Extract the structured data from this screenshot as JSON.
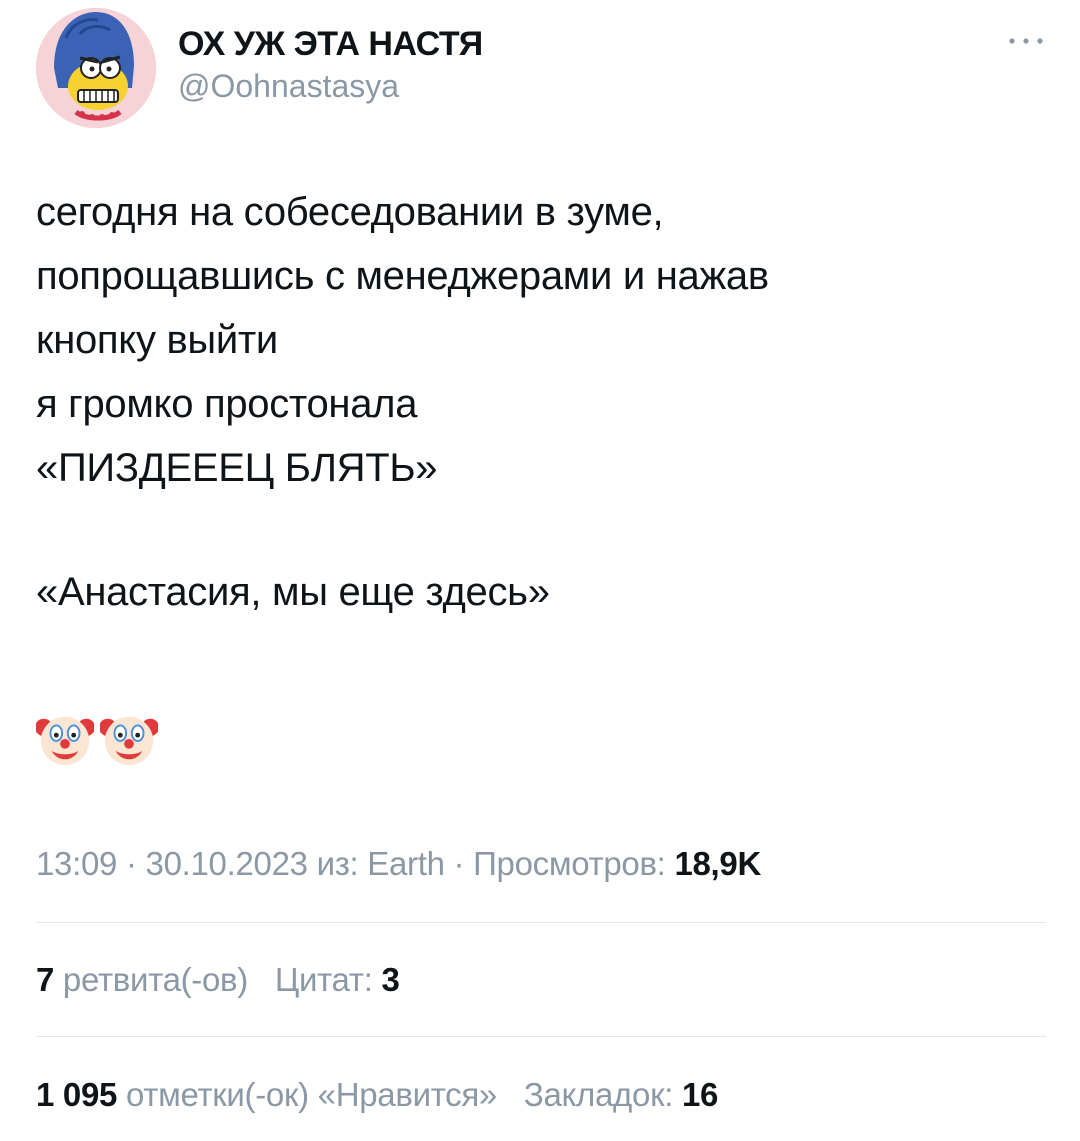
{
  "author": {
    "display_name": "ОХ УЖ ЭТА НАСТЯ",
    "handle": "@Oohnastasya",
    "avatar_icon": "cartoon-marge-avatar"
  },
  "more_menu": {
    "icon": "more-dots-icon"
  },
  "tweet": {
    "lines": [
      "сегодня на собеседовании в зуме,",
      "попрощавшись с менеджерами и нажав",
      "кнопку выйти",
      "я громко простонала",
      "«ПИЗДЕЕЕЦ БЛЯТЬ»"
    ],
    "reply_line": "«Анастасия, мы еще здесь»",
    "emojis": [
      "clown-face",
      "clown-face"
    ]
  },
  "meta": {
    "time": "13:09",
    "sep1": " · ",
    "date": "30.10.2023",
    "source_prefix": " из: ",
    "source": "Earth",
    "sep2": " · ",
    "views_label": "Просмотров: ",
    "views": "18,9K"
  },
  "stats_row1": {
    "retweets": "7",
    "retweets_label": " ретвита(-ов)",
    "quotes_label": "Цитат: ",
    "quotes": "3"
  },
  "stats_row2": {
    "likes": "1 095",
    "likes_label": " отметки(-ок) «Нравится»",
    "bookmarks_label": "Закладок: ",
    "bookmarks": "16"
  },
  "colors": {
    "text": "#0f1419",
    "secondary": "#8b98a5",
    "divider": "#e6e9ec",
    "avatar_bg": "#f3c2c9"
  }
}
